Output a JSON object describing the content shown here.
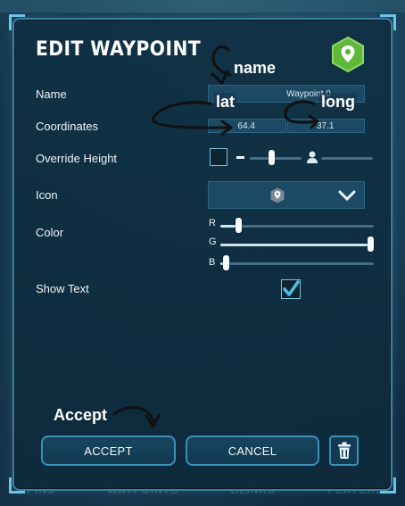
{
  "dialog": {
    "title": "EDIT WAYPOINT",
    "fields": {
      "name_label": "Name",
      "name_value": "Waypoint 0",
      "coordinates_label": "Coordinates",
      "latitude_value": "64.4",
      "longitude_value": "37.1",
      "override_height_label": "Override Height",
      "override_height_checked": false,
      "override_height_slider": 0.41,
      "icon_label": "Icon",
      "icon_selected": "waypoint-pin-icon",
      "color_label": "Color",
      "r_label": "R",
      "g_label": "G",
      "b_label": "B",
      "color_r": 0.1,
      "color_g": 1.0,
      "color_b": 0.02,
      "show_text_label": "Show Text",
      "show_text_checked": true
    },
    "buttons": {
      "accept": "ACCEPT",
      "cancel": "CANCEL",
      "delete_icon": "trash-icon"
    }
  },
  "annotations": {
    "name": "name",
    "lat": "lat",
    "long": "long",
    "accept": "Accept"
  },
  "bottom_tabs": [
    "PINS",
    "WAYPOINTS",
    "BLINKS",
    "PLAYERS"
  ],
  "colors": {
    "accent": "#3c8fb6",
    "waypoint_icon_green": "#5fb83a",
    "panel": "#123a51"
  }
}
